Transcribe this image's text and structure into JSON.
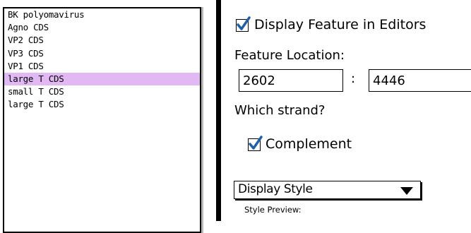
{
  "feature_list": {
    "items": [
      "BK polyomavirus",
      "Agno CDS",
      "VP2 CDS",
      "VP3 CDS",
      "VP1 CDS",
      "large T CDS",
      "small T CDS",
      "large T CDS"
    ],
    "selected_index": 5,
    "selected_color": "#e2b8f4"
  },
  "display_in_editors": {
    "label": "Display Feature in Editors",
    "checked": true,
    "check_color": "#1f5fa8"
  },
  "location": {
    "label": "Feature Location:",
    "start": "2602",
    "separator": ":",
    "end": "4446"
  },
  "strand": {
    "question": "Which strand?",
    "complement_label": "Complement",
    "complement_checked": true
  },
  "display_style": {
    "selected": "Display Style",
    "icon": "triangle-down-icon"
  },
  "preview": {
    "label": "Style Preview:"
  }
}
